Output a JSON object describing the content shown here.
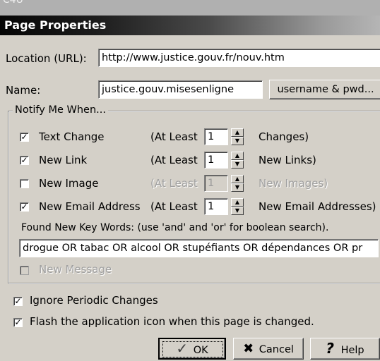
{
  "background_fragment": "C4U",
  "window": {
    "title": "Page Properties"
  },
  "location": {
    "label": "Location (URL):",
    "value": "http://www.justice.gouv.fr/nouv.htm"
  },
  "name": {
    "label": "Name:",
    "value": "justice.gouv.misesenligne",
    "button_label": "username & pwd..."
  },
  "notify": {
    "group_label": "Notify Me When...",
    "rows": [
      {
        "label": "Text Change",
        "checked": true,
        "enabled": true,
        "at_least": "(At Least",
        "count": "1",
        "suffix": "Changes)"
      },
      {
        "label": "New Link",
        "checked": true,
        "enabled": true,
        "at_least": "(At Least",
        "count": "1",
        "suffix": "New Links)"
      },
      {
        "label": "New Image",
        "checked": false,
        "enabled": false,
        "at_least": "(At Least",
        "count": "1",
        "suffix": "New Images)"
      },
      {
        "label": "New Email Address",
        "checked": true,
        "enabled": true,
        "at_least": "(At Least",
        "count": "1",
        "suffix": "New Email Addresses)"
      }
    ],
    "keywords_label": "Found New Key Words: (use 'and' and 'or' for boolean search).",
    "keywords_value": "drogue OR tabac OR alcool OR stupéfiants OR dépendances OR pr",
    "new_message_label": "New Message",
    "new_message_checked": false
  },
  "options": {
    "ignore_periodic": {
      "label": "Ignore Periodic Changes",
      "checked": true
    },
    "flash_icon": {
      "label": "Flash the application icon when this page is changed.",
      "checked": true
    }
  },
  "buttons": {
    "ok": "OK",
    "cancel": "Cancel",
    "help": "Help"
  },
  "icons": {
    "checkmark": "check-icon",
    "cancel": "x-icon",
    "help": "question-icon",
    "spin": "spinner-arrows-icon"
  }
}
